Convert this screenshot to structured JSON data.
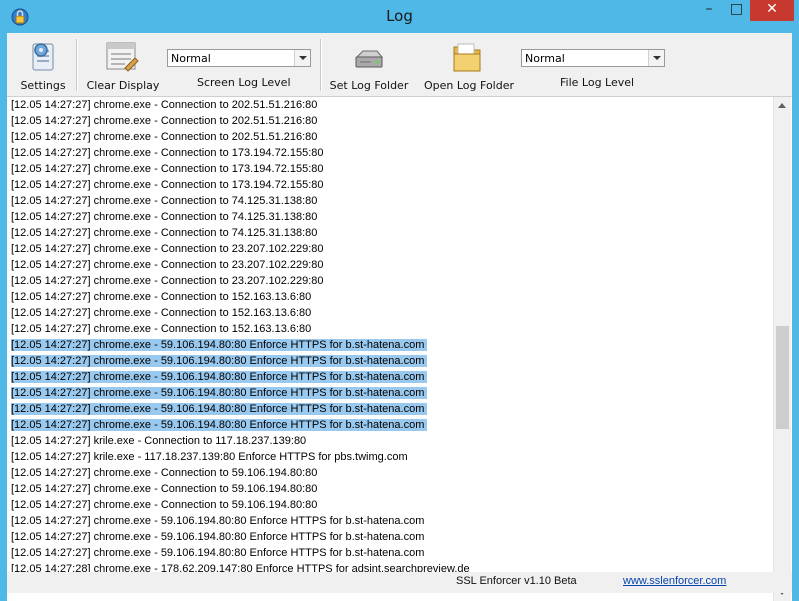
{
  "window": {
    "title": "Log"
  },
  "toolbar": {
    "settings_label": "Settings",
    "clear_display_label": "Clear Display",
    "screen_log_level": {
      "value": "Normal",
      "caption": "Screen Log Level"
    },
    "set_log_folder_label": "Set Log Folder",
    "open_log_folder_label": "Open Log Folder",
    "file_log_level": {
      "value": "Normal",
      "caption": "File Log Level"
    }
  },
  "log": {
    "lines": [
      "[12.05 14:27:27] chrome.exe - Connection to 202.51.51.216:80",
      "[12.05 14:27:27] chrome.exe - Connection to 202.51.51.216:80",
      "[12.05 14:27:27] chrome.exe - Connection to 202.51.51.216:80",
      "[12.05 14:27:27] chrome.exe - Connection to 173.194.72.155:80",
      "[12.05 14:27:27] chrome.exe - Connection to 173.194.72.155:80",
      "[12.05 14:27:27] chrome.exe - Connection to 173.194.72.155:80",
      "[12.05 14:27:27] chrome.exe - Connection to 74.125.31.138:80",
      "[12.05 14:27:27] chrome.exe - Connection to 74.125.31.138:80",
      "[12.05 14:27:27] chrome.exe - Connection to 74.125.31.138:80",
      "[12.05 14:27:27] chrome.exe - Connection to 23.207.102.229:80",
      "[12.05 14:27:27] chrome.exe - Connection to 23.207.102.229:80",
      "[12.05 14:27:27] chrome.exe - Connection to 23.207.102.229:80",
      "[12.05 14:27:27] chrome.exe - Connection to 152.163.13.6:80",
      "[12.05 14:27:27] chrome.exe - Connection to 152.163.13.6:80",
      "[12.05 14:27:27] chrome.exe - Connection to 152.163.13.6:80",
      "[12.05 14:27:27] chrome.exe - 59.106.194.80:80 Enforce HTTPS for b.st-hatena.com",
      "[12.05 14:27:27] chrome.exe - 59.106.194.80:80 Enforce HTTPS for b.st-hatena.com",
      "[12.05 14:27:27] chrome.exe - 59.106.194.80:80 Enforce HTTPS for b.st-hatena.com",
      "[12.05 14:27:27] chrome.exe - 59.106.194.80:80 Enforce HTTPS for b.st-hatena.com",
      "[12.05 14:27:27] chrome.exe - 59.106.194.80:80 Enforce HTTPS for b.st-hatena.com",
      "[12.05 14:27:27] chrome.exe - 59.106.194.80:80 Enforce HTTPS for b.st-hatena.com",
      "[12.05 14:27:27] krile.exe - Connection to 117.18.237.139:80",
      "[12.05 14:27:27] krile.exe - 117.18.237.139:80 Enforce HTTPS for pbs.twimg.com",
      "[12.05 14:27:27] chrome.exe - Connection to 59.106.194.80:80",
      "[12.05 14:27:27] chrome.exe - Connection to 59.106.194.80:80",
      "[12.05 14:27:27] chrome.exe - Connection to 59.106.194.80:80",
      "[12.05 14:27:27] chrome.exe - 59.106.194.80:80 Enforce HTTPS for b.st-hatena.com",
      "[12.05 14:27:27] chrome.exe - 59.106.194.80:80 Enforce HTTPS for b.st-hatena.com",
      "[12.05 14:27:27] chrome.exe - 59.106.194.80:80 Enforce HTTPS for b.st-hatena.com",
      "[12.05 14:27:28] chrome.exe - 178.62.209.147:80 Enforce HTTPS for adsint.searchpreview.de"
    ],
    "selected_from": 15,
    "selected_to": 20
  },
  "scrollbar": {
    "thumb_start_fraction": 0.45,
    "thumb_size_fraction": 0.22
  },
  "status": {
    "version_text": "SSL Enforcer v1.10 Beta",
    "link_text": "www.sslenforcer.com"
  }
}
